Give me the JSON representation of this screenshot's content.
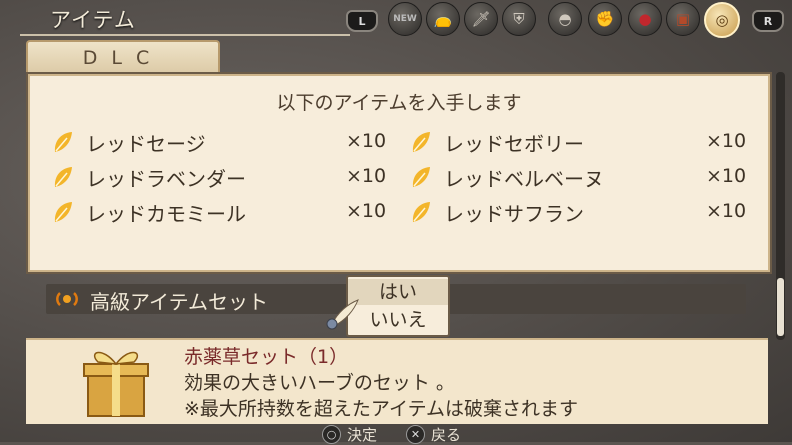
{
  "header": {
    "title": "アイテム",
    "l_label": "L",
    "r_label": "R"
  },
  "categories": [
    {
      "icon": "new-icon",
      "text": "NEW"
    },
    {
      "icon": "bag-icon",
      "text": "👝"
    },
    {
      "icon": "sword-icon",
      "text": "🗡"
    },
    {
      "icon": "armor-icon",
      "text": "⛨"
    },
    {
      "icon": "helmet-icon",
      "text": "◓"
    },
    {
      "icon": "gauntlet-icon",
      "text": "✊"
    },
    {
      "icon": "apple-icon",
      "text": "●"
    },
    {
      "icon": "chest-icon",
      "text": "▣"
    },
    {
      "icon": "dlc-icon",
      "text": "◎"
    }
  ],
  "tab": {
    "label": "DLC"
  },
  "panel": {
    "heading": "以下のアイテムを入手します",
    "items": [
      {
        "name": "レッドセージ",
        "qty": "×10"
      },
      {
        "name": "レッドセボリー",
        "qty": "×10"
      },
      {
        "name": "レッドラベンダー",
        "qty": "×10"
      },
      {
        "name": "レッドベルベーヌ",
        "qty": "×10"
      },
      {
        "name": "レッドカモミール",
        "qty": "×10"
      },
      {
        "name": "レッドサフラン",
        "qty": "×10"
      }
    ]
  },
  "set_row": {
    "label": "高級アイテムセット"
  },
  "popup": {
    "yes": "はい",
    "no": "いいえ"
  },
  "description": {
    "title": "赤薬草セット（1）",
    "line1": "効果の大きいハーブのセット 。",
    "line2": "※最大所持数を超えたアイテムは破棄されます"
  },
  "help": {
    "confirm": "決定",
    "back": "戻る"
  },
  "colors": {
    "leaf": "#f3b52a",
    "accent_gold": "#d9a441",
    "panel_bg": "#f7eddb"
  }
}
